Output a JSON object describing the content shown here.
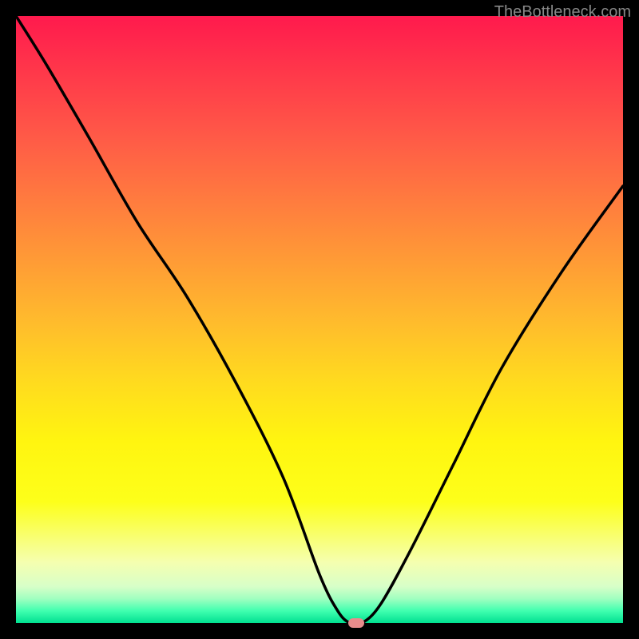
{
  "watermark": "TheBottleneck.com",
  "chart_data": {
    "type": "line",
    "title": "",
    "xlabel": "",
    "ylabel": "",
    "xlim": [
      0,
      100
    ],
    "ylim": [
      0,
      100
    ],
    "grid": false,
    "series": [
      {
        "name": "bottleneck-curve",
        "x": [
          0,
          5,
          12,
          20,
          28,
          36,
          44,
          50,
          53,
          55,
          57,
          60,
          65,
          72,
          80,
          90,
          100
        ],
        "y": [
          100,
          92,
          80,
          66,
          54,
          40,
          24,
          8,
          2,
          0,
          0,
          3,
          12,
          26,
          42,
          58,
          72
        ]
      }
    ],
    "marker": {
      "x": 56,
      "y": 0
    },
    "gradient_stops": [
      {
        "pos": 0,
        "color": "#ff1a4d"
      },
      {
        "pos": 50,
        "color": "#ffba2d"
      },
      {
        "pos": 80,
        "color": "#fdff1a"
      },
      {
        "pos": 100,
        "color": "#00e090"
      }
    ]
  }
}
